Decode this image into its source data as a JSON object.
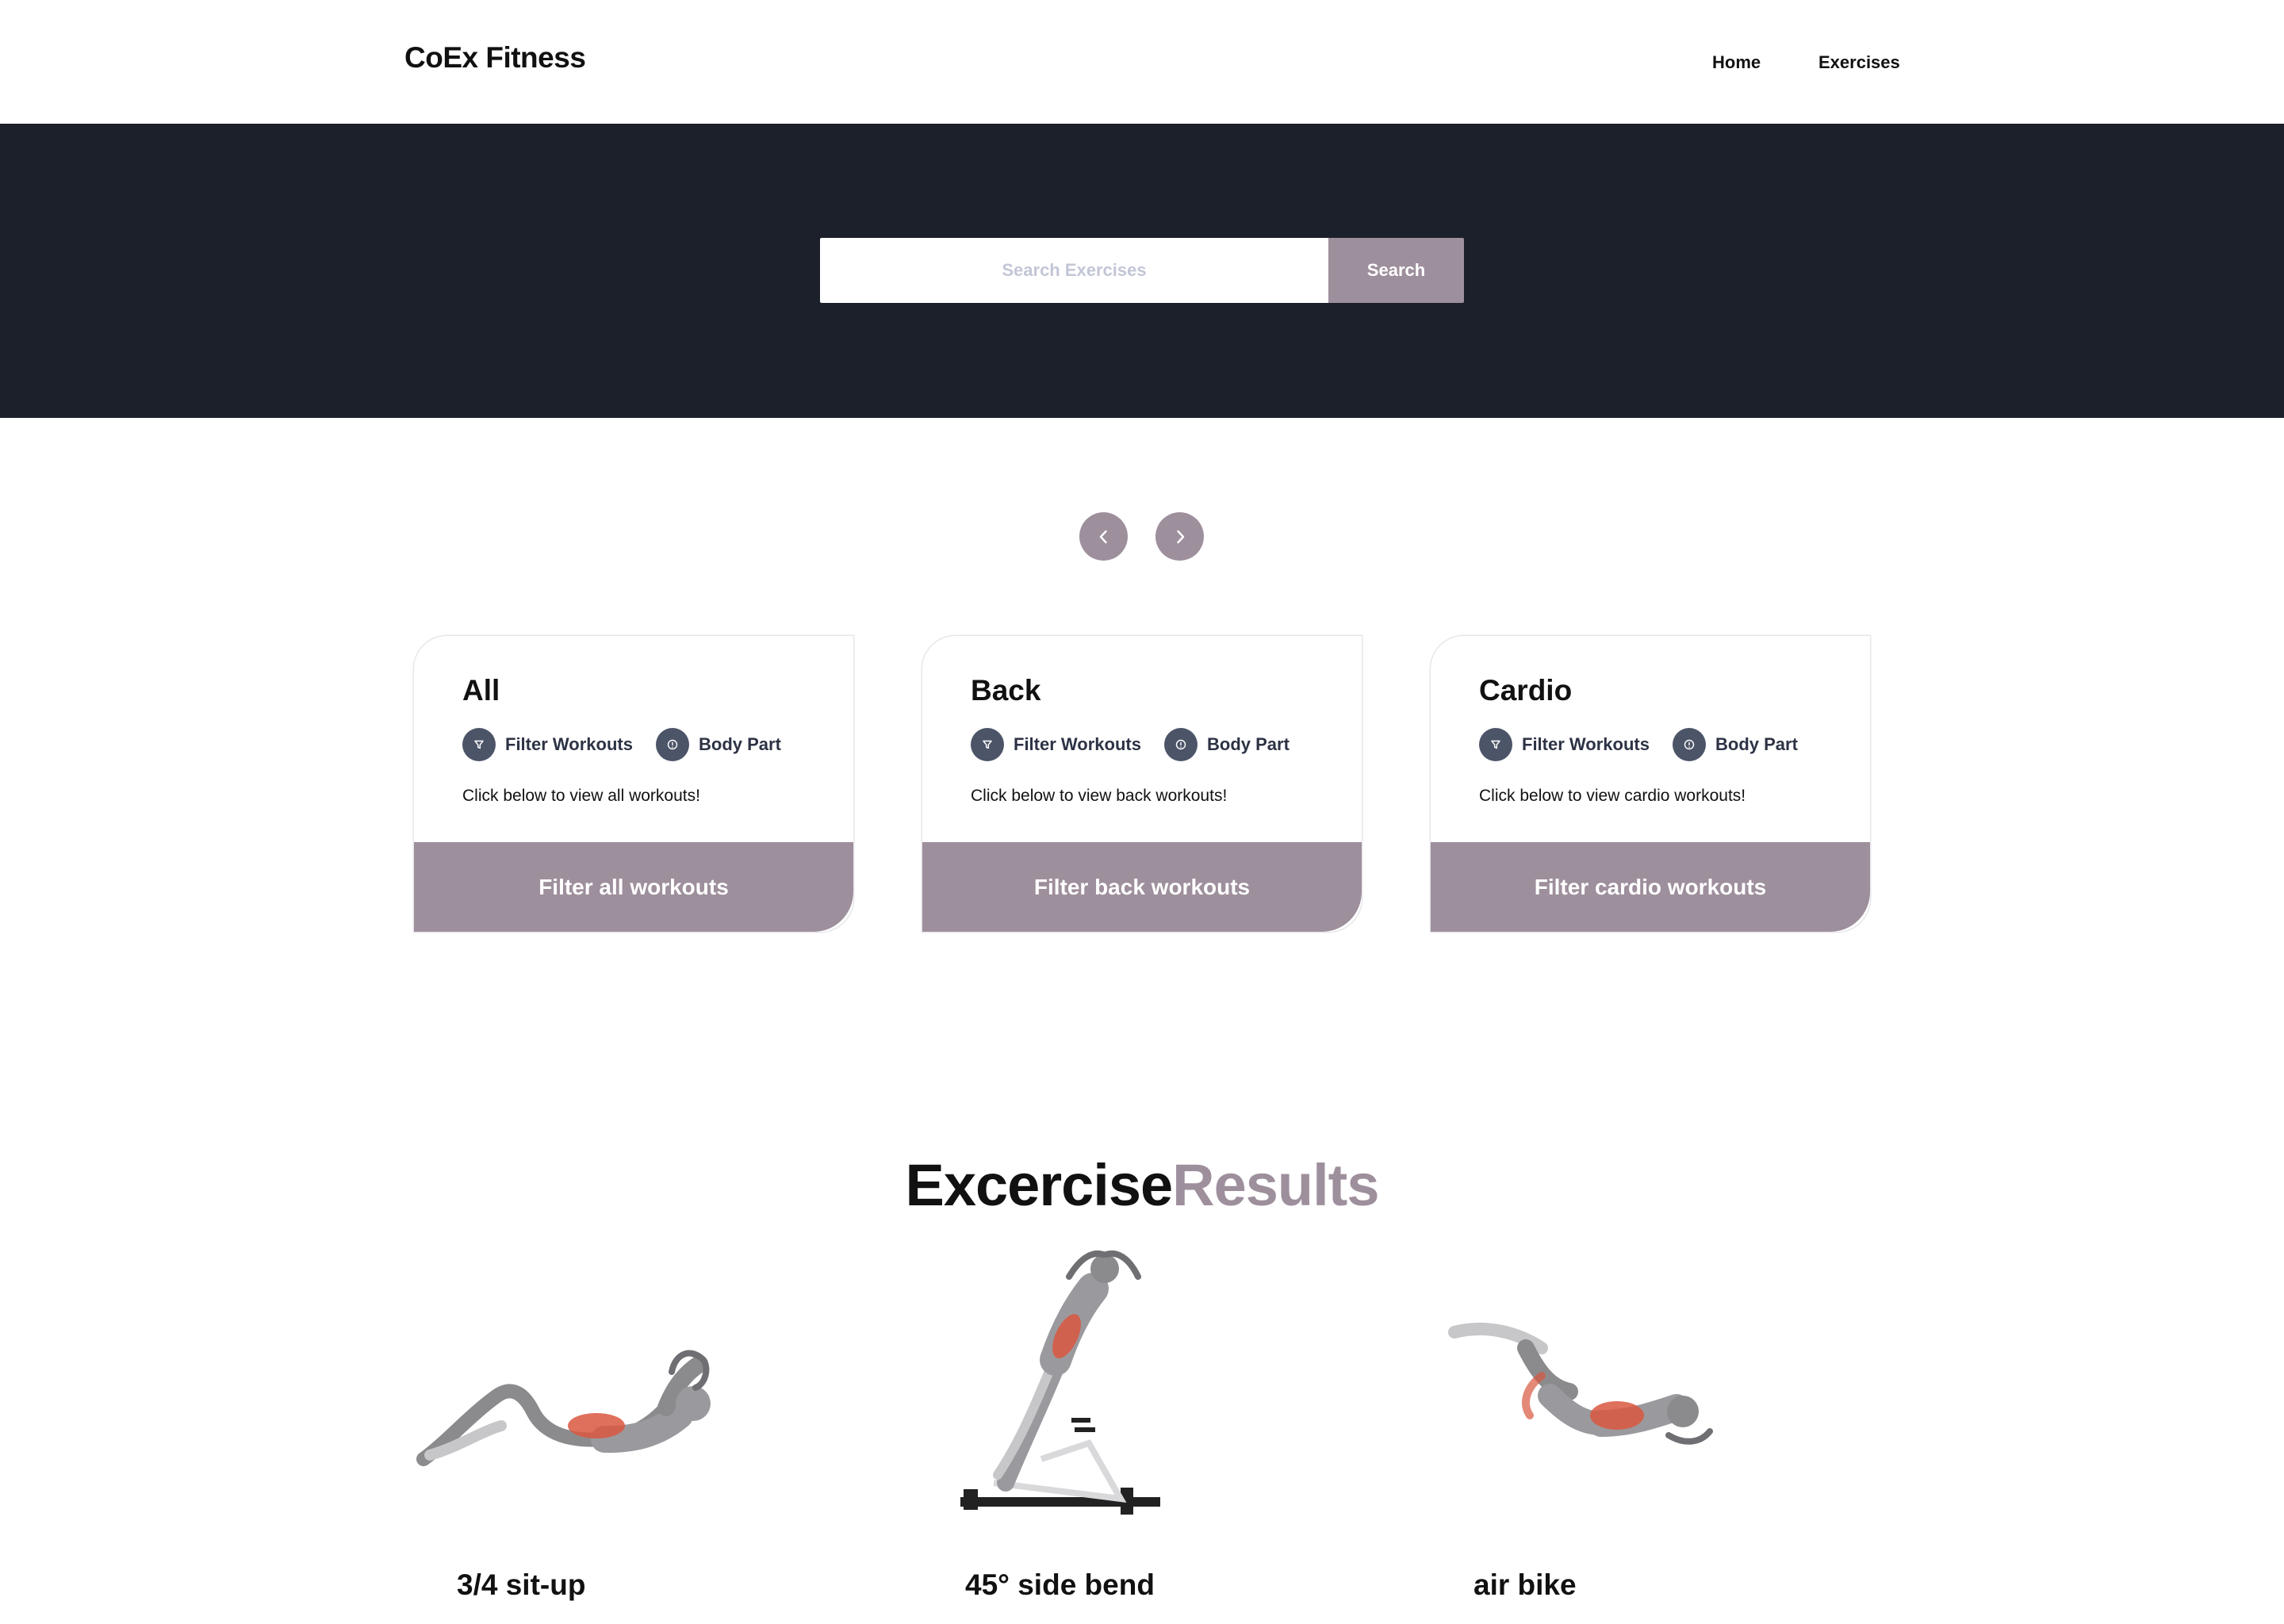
{
  "brand": "CoEx Fitness",
  "nav": {
    "home": "Home",
    "exercises": "Exercises"
  },
  "search": {
    "placeholder": "Search Exercises",
    "button": "Search"
  },
  "carousel": {
    "prev_icon": "chevron-left-icon",
    "next_icon": "chevron-right-icon"
  },
  "categories": [
    {
      "title": "All",
      "filter_label": "Filter Workouts",
      "body_label": "Body Part",
      "description": "Click below to view all workouts!",
      "button": "Filter all workouts"
    },
    {
      "title": "Back",
      "filter_label": "Filter Workouts",
      "body_label": "Body Part",
      "description": "Click below to view back workouts!",
      "button": "Filter back workouts"
    },
    {
      "title": "Cardio",
      "filter_label": "Filter Workouts",
      "body_label": "Body Part",
      "description": "Click below to view cardio workouts!",
      "button": "Filter cardio workouts"
    }
  ],
  "results": {
    "heading_part1": "Excercise",
    "heading_part2": "Results",
    "items": [
      {
        "name": "3/4 sit-up",
        "image": "exercise-illustration"
      },
      {
        "name": "45° side bend",
        "image": "exercise-illustration"
      },
      {
        "name": "air bike",
        "image": "exercise-illustration"
      }
    ]
  },
  "colors": {
    "accent": "#9e8f9d",
    "hero_bg": "#1c202b",
    "chip_icon_bg": "#4c5468",
    "muscle_highlight": "#d9573f"
  }
}
